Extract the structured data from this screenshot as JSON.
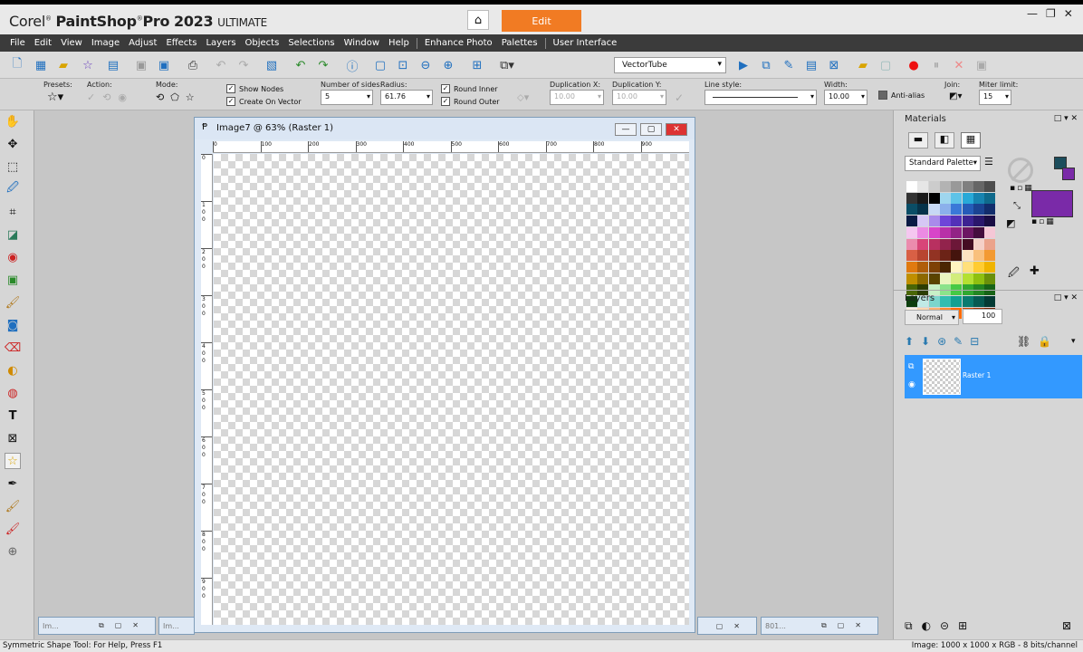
{
  "app": {
    "brand": "Corel",
    "product": "PaintShop",
    "pro": "Pro",
    "year": "2023",
    "edition": "ULTIMATE",
    "tab_edit": "Edit"
  },
  "menu": [
    "File",
    "Edit",
    "View",
    "Image",
    "Adjust",
    "Effects",
    "Layers",
    "Objects",
    "Selections",
    "Window",
    "Help",
    "Enhance Photo",
    "Palettes",
    "User Interface"
  ],
  "toolbar": {
    "script_select": "VectorTube"
  },
  "options": {
    "presets_label": "Presets:",
    "action_label": "Action:",
    "mode_label": "Mode:",
    "show_nodes": "Show Nodes",
    "create_on_vector": "Create On Vector",
    "sides_label": "Number of sides:",
    "sides_value": "5",
    "radius_label": "Radius:",
    "radius_value": "61.76",
    "round_inner": "Round Inner",
    "round_outer": "Round Outer",
    "dupx_label": "Duplication X:",
    "dupx_value": "10.00",
    "dupy_label": "Duplication Y:",
    "dupy_value": "10.00",
    "line_style_label": "Line style:",
    "width_label": "Width:",
    "width_value": "10.00",
    "antialias": "Anti-alias",
    "join_label": "Join:",
    "miter_label": "Miter limit:",
    "miter_value": "15"
  },
  "image_window": {
    "title": "Image7 @  63% (Raster 1)"
  },
  "ruler": {
    "top_ticks": [
      "0",
      "100",
      "200",
      "300",
      "400",
      "500",
      "600",
      "700",
      "800",
      "900"
    ],
    "left_ticks": [
      "0",
      "100",
      "200",
      "300",
      "400",
      "500",
      "600",
      "700",
      "800",
      "900"
    ]
  },
  "minimized": [
    "Im...",
    "Im...",
    "801..."
  ],
  "materials": {
    "title": "Materials",
    "palette_select": "Standard Palette",
    "fg_color": "#1c4d5c",
    "bg_color": "#7a2aa8"
  },
  "layers": {
    "title": "Layers",
    "blend_mode": "Normal",
    "opacity": "100",
    "layer_name": "Raster 1"
  },
  "status": {
    "left": "Symmetric Shape Tool: For Help, Press F1",
    "right": "Image:  1000 x 1000 x RGB - 8 bits/channel"
  }
}
